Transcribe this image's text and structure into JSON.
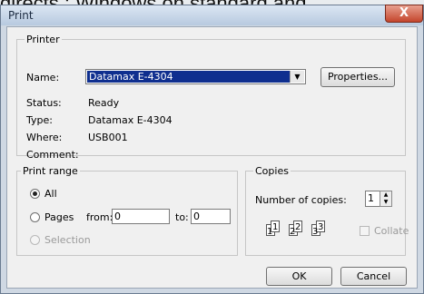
{
  "background_text": "directs : Windows on standard and",
  "dialog": {
    "title": "Print",
    "close_label": "X"
  },
  "printer": {
    "group_label": "Printer",
    "name_label": "Name:",
    "name_value": "Datamax E-4304",
    "properties_label": "Properties...",
    "status_label": "Status:",
    "status_value": "Ready",
    "type_label": "Type:",
    "type_value": "Datamax E-4304",
    "where_label": "Where:",
    "where_value": "USB001",
    "comment_label": "Comment:"
  },
  "print_range": {
    "group_label": "Print range",
    "all_label": "All",
    "pages_label": "Pages",
    "from_label": "from:",
    "from_value": "0",
    "to_label": "to:",
    "to_value": "0",
    "selection_label": "Selection",
    "selected": "All"
  },
  "copies": {
    "group_label": "Copies",
    "number_label": "Number of copies:",
    "number_value": "1",
    "collate_label": "Collate",
    "collate_checked": false,
    "page_icon_labels": [
      "1",
      "1",
      "2",
      "2",
      "3",
      "3"
    ]
  },
  "buttons": {
    "ok_label": "OK",
    "cancel_label": "Cancel"
  }
}
